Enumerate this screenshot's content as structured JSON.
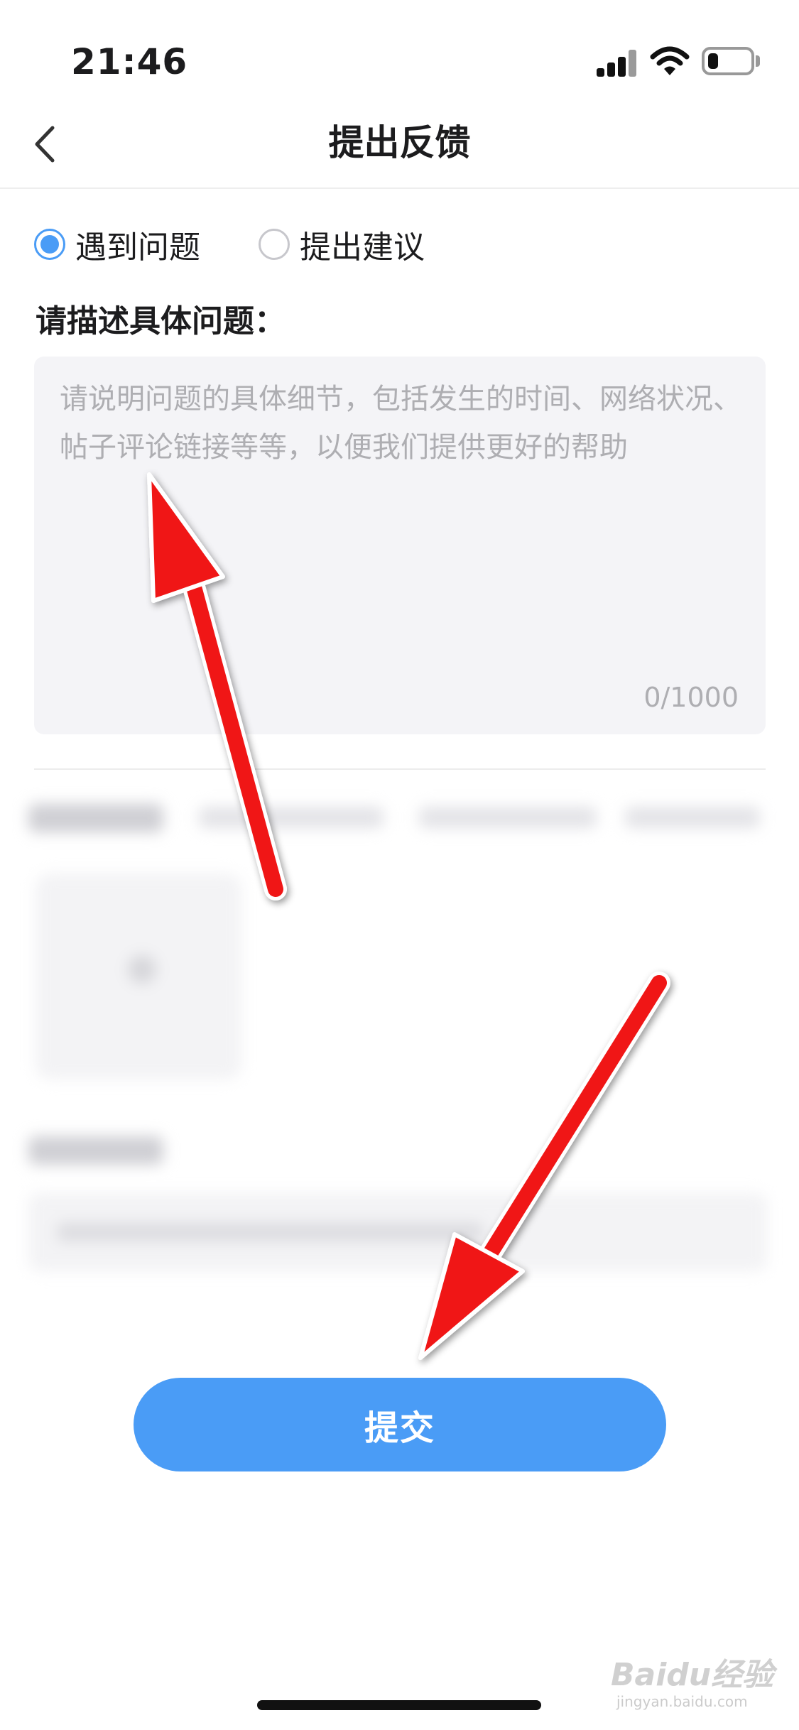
{
  "status_bar": {
    "time": "21:46",
    "signal_icon": "cellular-signal-icon",
    "wifi_icon": "wifi-icon",
    "battery_icon": "battery-icon",
    "battery_level_fraction": 0.25
  },
  "nav": {
    "back_icon": "chevron-left-icon",
    "title": "提出反馈"
  },
  "feedback_type": {
    "options": [
      {
        "label": "遇到问题",
        "selected": true
      },
      {
        "label": "提出建议",
        "selected": false
      }
    ]
  },
  "description": {
    "label": "请描述具体问题：",
    "placeholder": "请说明问题的具体细节，包括发生的时间、网络状况、帖子评论链接等等，以便我们提供更好的帮助",
    "value": "",
    "counter": "0/1000"
  },
  "submit": {
    "label": "提交"
  },
  "watermark": {
    "text": "Baidu经验",
    "sub": "jingyan.baidu.com"
  },
  "colors": {
    "accent": "#4a9cf6",
    "annotation_arrow": "#f01515"
  }
}
